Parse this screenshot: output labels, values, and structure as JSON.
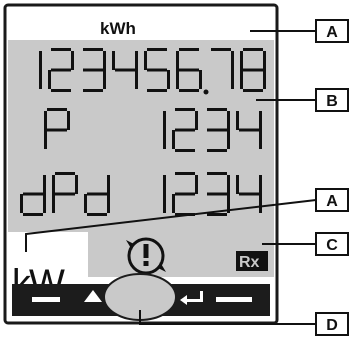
{
  "display": {
    "unit_top": "kWh",
    "row1": "12345678",
    "row2_label": "P",
    "row2_value": "1234",
    "row3_label": "dPd",
    "row3_value": "1234",
    "unit_bottom": "kW",
    "rx_badge": "Rx"
  },
  "buttons": [
    {
      "name": "up-button",
      "symbol": "—  ▲"
    },
    {
      "name": "enter-button",
      "symbol": "↵  —"
    }
  ],
  "callouts": [
    {
      "id": "callout-a-top",
      "label": "A"
    },
    {
      "id": "callout-b",
      "label": "B"
    },
    {
      "id": "callout-a-bottom",
      "label": "A"
    },
    {
      "id": "callout-c",
      "label": "C"
    },
    {
      "id": "callout-d",
      "label": "D"
    }
  ],
  "colors": {
    "lcd_background": "#c9c9c9",
    "segment_black": "#111111",
    "frame": "#1a1a1a",
    "button_bar": "#1c1c1c",
    "button_center": "#c9c9c9"
  }
}
